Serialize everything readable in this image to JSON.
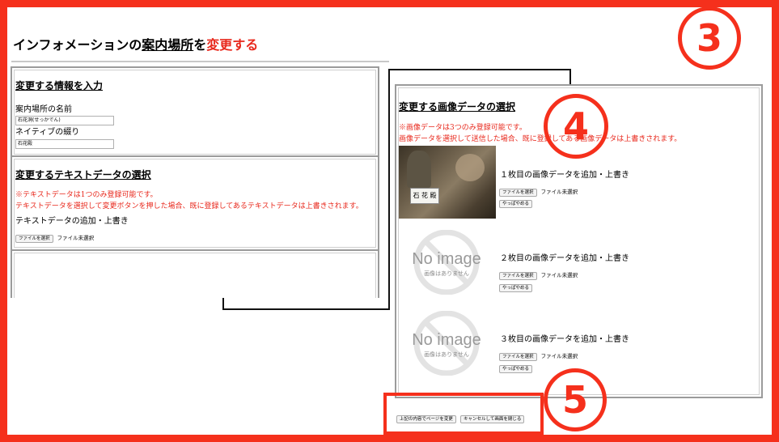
{
  "page": {
    "title_part1": "インフォメーションの",
    "title_part2": "案内場所",
    "title_part3": "を",
    "title_part4": "変更する"
  },
  "info_section": {
    "heading": "変更する情報を入力",
    "name_label": "案内場所の名前",
    "name_value": "石花洞(せっかでん)",
    "native_label": "ネイティブの綴り",
    "native_value": "石花殿"
  },
  "text_section": {
    "heading": "変更するテキストデータの選択",
    "note1": "※テキストデータは1つのみ登録可能です。",
    "note2": "テキストデータを選択して変更ボタンを押した場合、既に登録してあるテキストデータは上書きされます。",
    "add_label": "テキストデータの追加・上書き",
    "choose_file": "ファイルを選択",
    "no_file": "ファイル未選択"
  },
  "image_section": {
    "heading": "変更する画像データの選択",
    "note1": "※画像データは3つのみ登録可能です。",
    "note2": "画像データを選択して送信した場合、既に登録してある画像データは上書きされます。",
    "items": [
      {
        "label": "１枚目の画像データを追加・上書き",
        "choose_file": "ファイルを選択",
        "no_file": "ファイル未選択",
        "cancel": "やっぱやめる",
        "photo_sign": "石 花 殿"
      },
      {
        "label": "２枚目の画像データを追加・上書き",
        "choose_file": "ファイルを選択",
        "no_file": "ファイル未選択",
        "cancel": "やっぱやめる",
        "noimage_title": "No image",
        "noimage_sub": "画像はありません"
      },
      {
        "label": "３枚目の画像データを追加・上書き",
        "choose_file": "ファイルを選択",
        "no_file": "ファイル未選択",
        "cancel": "やっぱやめる",
        "noimage_title": "No image",
        "noimage_sub": "画像はありません"
      }
    ]
  },
  "actions": {
    "submit": "上記の内容でページを変更",
    "cancel": "キャンセルして画面を閉じる"
  },
  "annotations": {
    "badge_3": "3",
    "badge_4": "4",
    "badge_5": "5",
    "color": "#f5301c"
  }
}
